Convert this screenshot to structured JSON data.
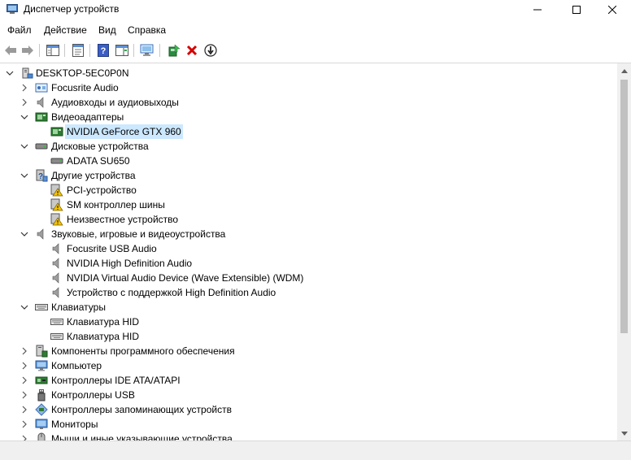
{
  "window": {
    "title": "Диспетчер устройств",
    "minimize_glyph": "—",
    "maximize_glyph": "☐",
    "close_glyph": "✕"
  },
  "menu": {
    "items": [
      "Файл",
      "Действие",
      "Вид",
      "Справка"
    ]
  },
  "toolbar": {
    "buttons": [
      "back-arrow-icon",
      "forward-arrow-icon",
      "show-hide-console-tree-icon",
      "properties-icon",
      "help-icon",
      "action-pane-icon",
      "scan-hardware-icon",
      "update-driver-icon",
      "uninstall-icon",
      "disable-device-icon"
    ]
  },
  "tree": {
    "root": "DESKTOP-5EC0P0N",
    "nodes": [
      {
        "label": "Focusrite Audio",
        "icon": "audio-device-icon"
      },
      {
        "label": "Аудиовходы и аудиовыходы",
        "icon": "speaker-icon"
      },
      {
        "label": "Видеоадаптеры",
        "icon": "display-adapter-icon"
      },
      {
        "label": "NVIDIA GeForce GTX 960",
        "icon": "display-adapter-icon",
        "selected": true
      },
      {
        "label": "Дисковые устройства",
        "icon": "disk-drive-icon"
      },
      {
        "label": "ADATA SU650",
        "icon": "disk-drive-icon"
      },
      {
        "label": "Другие устройства",
        "icon": "other-devices-icon"
      },
      {
        "label": "PCI-устройство",
        "icon": "warning-device-icon"
      },
      {
        "label": "SM контроллер шины",
        "icon": "warning-device-icon"
      },
      {
        "label": "Неизвестное устройство",
        "icon": "warning-device-icon"
      },
      {
        "label": "Звуковые, игровые и видеоустройства",
        "icon": "speaker-icon"
      },
      {
        "label": "Focusrite USB Audio",
        "icon": "speaker-icon"
      },
      {
        "label": "NVIDIA High Definition Audio",
        "icon": "speaker-icon"
      },
      {
        "label": "NVIDIA Virtual Audio Device (Wave Extensible) (WDM)",
        "icon": "speaker-icon"
      },
      {
        "label": "Устройство с поддержкой High Definition Audio",
        "icon": "speaker-icon"
      },
      {
        "label": "Клавиатуры",
        "icon": "keyboard-icon"
      },
      {
        "label": "Клавиатура HID",
        "icon": "keyboard-icon"
      },
      {
        "label": "Клавиатура HID",
        "icon": "keyboard-icon"
      },
      {
        "label": "Компоненты программного обеспечения",
        "icon": "software-component-icon"
      },
      {
        "label": "Компьютер",
        "icon": "computer-icon"
      },
      {
        "label": "Контроллеры IDE ATA/ATAPI",
        "icon": "ide-controller-icon"
      },
      {
        "label": "Контроллеры USB",
        "icon": "usb-icon"
      },
      {
        "label": "Контроллеры запоминающих устройств",
        "icon": "storage-controller-icon"
      },
      {
        "label": "Мониторы",
        "icon": "monitor-icon"
      },
      {
        "label": "Мыши и иные указывающие устройства",
        "icon": "mouse-icon"
      }
    ]
  },
  "colors": {
    "selection": "#cce8ff",
    "warning": "#f5c400",
    "uninstall_red": "#d40000"
  }
}
